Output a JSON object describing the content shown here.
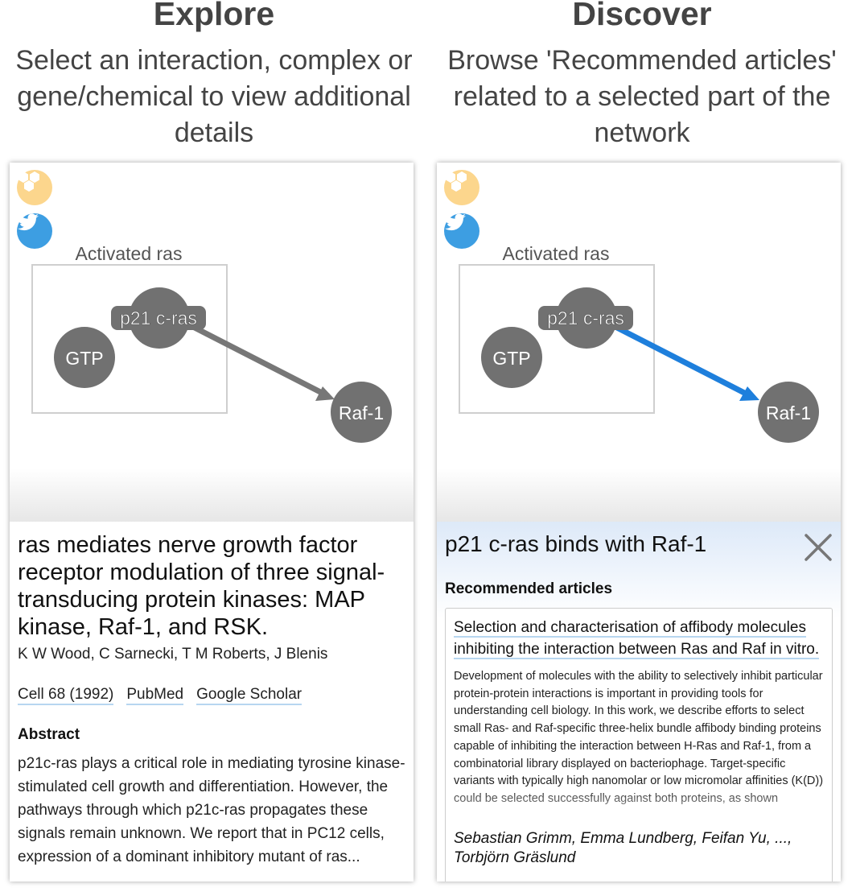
{
  "explore": {
    "title": "Explore",
    "subtitle": "Select an interaction, complex or gene/chemical to view additional details"
  },
  "discover": {
    "title": "Discover",
    "subtitle": "Browse 'Recommended articles' related to a selected part of the network"
  },
  "network": {
    "complex_label": "Activated ras",
    "nodes": {
      "p21": "p21 c-ras",
      "gtp": "GTP",
      "raf": "Raf-1"
    },
    "edge_color_default": "#777777",
    "edge_color_selected": "#1e7fdc",
    "node_color": "#717171"
  },
  "icons": {
    "app": "hexagon-cluster-icon",
    "social": "twitter-bird-icon"
  },
  "left_panel": {
    "article_title": "ras mediates nerve growth factor receptor modulation of three signal-transducing protein kinases: MAP kinase, Raf-1, and RSK.",
    "authors": "K W Wood, C Sarnecki, T M Roberts, J Blenis",
    "links": [
      "Cell 68 (1992)",
      "PubMed",
      "Google Scholar"
    ],
    "abstract_heading": "Abstract",
    "abstract": "p21c-ras plays a critical role in mediating tyrosine kinase-stimulated cell growth and differentiation. However, the pathways through which p21c-ras propagates these signals remain unknown. We report that in PC12 cells, expression of a dominant inhibitory mutant of ras..."
  },
  "right_panel": {
    "interaction_title": "p21 c-ras binds with Raf-1",
    "recommended_heading": "Recommended articles",
    "article": {
      "title": "Selection and characterisation of affibody molecules inhibiting the interaction between Ras and Raf in vitro.",
      "abstract": "Development of molecules with the ability to selectively inhibit particular protein-protein interactions is important in providing tools for understanding cell biology. In this work, we describe efforts to select small Ras- and Raf-specific three-helix bundle affibody binding proteins capable of inhibiting the interaction between H-Ras and Raf-1, from a combinatorial library displayed on bacteriophage. Target-specific variants with typically high nanomolar or low micromolar affinities (K(D)) could be selected successfully against both proteins, as shown",
      "authors": "Sebastian Grimm, Emma Lundberg, Feifan Yu, ..., Torbjörn Gräslund"
    }
  }
}
